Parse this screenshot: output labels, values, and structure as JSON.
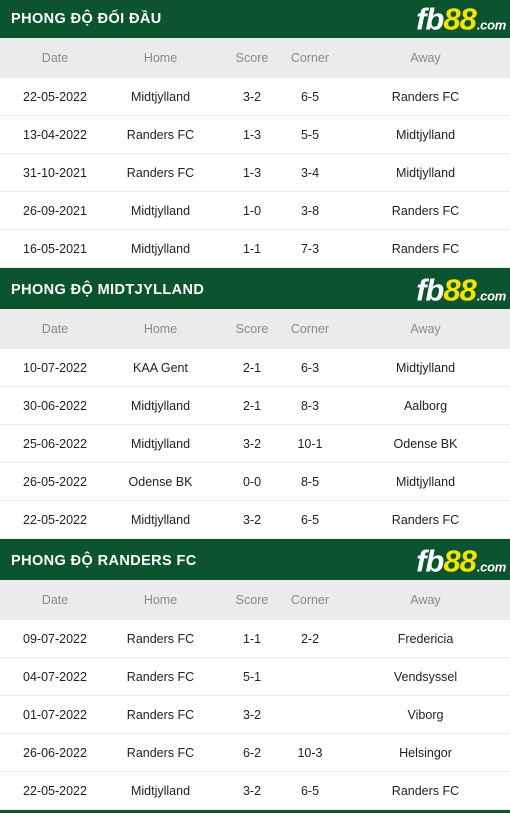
{
  "brand": {
    "fb": "fb",
    "eightyeight": "88",
    "com": ".com",
    "yellow": "#f5e400",
    "green": "#0c5330"
  },
  "colors": {
    "header_green": "#0c5330",
    "score_red": "#a33030",
    "midtjylland_orange": "#e8883a",
    "randers_blue": "#5ba9e0",
    "column_header_bg": "#ebebeb",
    "column_header_text": "#8a8a8a"
  },
  "columns": {
    "date": "Date",
    "home": "Home",
    "score": "Score",
    "corner": "Corner",
    "away": "Away"
  },
  "sections": [
    {
      "title": "PHONG ĐỘ ĐỐI ĐẦU",
      "rows": [
        {
          "date": "22-05-2022",
          "home": "Midtjylland",
          "home_style": "team-mid",
          "score": "3-2",
          "corner": "6-5",
          "away": "Randers FC",
          "away_style": "team-ran"
        },
        {
          "date": "13-04-2022",
          "home": "Randers FC",
          "home_style": "team-ran",
          "score": "1-3",
          "corner": "5-5",
          "away": "Midtjylland",
          "away_style": "team-mid"
        },
        {
          "date": "31-10-2021",
          "home": "Randers FC",
          "home_style": "team-ran",
          "score": "1-3",
          "corner": "3-4",
          "away": "Midtjylland",
          "away_style": "team-mid"
        },
        {
          "date": "26-09-2021",
          "home": "Midtjylland",
          "home_style": "team-mid",
          "score": "1-0",
          "corner": "3-8",
          "away": "Randers FC",
          "away_style": "team-ran"
        },
        {
          "date": "16-05-2021",
          "home": "Midtjylland",
          "home_style": "team-mid",
          "score": "1-1",
          "corner": "7-3",
          "away": "Randers FC",
          "away_style": "team-ran"
        }
      ]
    },
    {
      "title": "PHONG ĐỘ MIDTJYLLAND",
      "rows": [
        {
          "date": "10-07-2022",
          "home": "KAA Gent",
          "home_style": "team-neutral",
          "score": "2-1",
          "corner": "6-3",
          "away": "Midtjylland",
          "away_style": "team-mid"
        },
        {
          "date": "30-06-2022",
          "home": "Midtjylland",
          "home_style": "team-mid",
          "score": "2-1",
          "corner": "8-3",
          "away": "Aalborg",
          "away_style": "team-neutral"
        },
        {
          "date": "25-06-2022",
          "home": "Midtjylland",
          "home_style": "team-mid",
          "score": "3-2",
          "corner": "10-1",
          "away": "Odense BK",
          "away_style": "team-neutral"
        },
        {
          "date": "26-05-2022",
          "home": "Odense BK",
          "home_style": "team-neutral",
          "score": "0-0",
          "corner": "8-5",
          "away": "Midtjylland",
          "away_style": "team-mid"
        },
        {
          "date": "22-05-2022",
          "home": "Midtjylland",
          "home_style": "team-mid",
          "score": "3-2",
          "corner": "6-5",
          "away": "Randers FC",
          "away_style": "team-neutral"
        }
      ]
    },
    {
      "title": "PHONG ĐỘ RANDERS FC",
      "rows": [
        {
          "date": "09-07-2022",
          "home": "Randers FC",
          "home_style": "team-ran",
          "score": "1-1",
          "corner": "2-2",
          "away": "Fredericia",
          "away_style": "team-neutral"
        },
        {
          "date": "04-07-2022",
          "home": "Randers FC",
          "home_style": "team-ran",
          "score": "5-1",
          "corner": "",
          "away": "Vendsyssel",
          "away_style": "team-neutral"
        },
        {
          "date": "01-07-2022",
          "home": "Randers FC",
          "home_style": "team-ran",
          "score": "3-2",
          "corner": "",
          "away": "Viborg",
          "away_style": "team-neutral"
        },
        {
          "date": "26-06-2022",
          "home": "Randers FC",
          "home_style": "team-ran",
          "score": "6-2",
          "corner": "10-3",
          "away": "Helsingor",
          "away_style": "team-neutral"
        },
        {
          "date": "22-05-2022",
          "home": "Midtjylland",
          "home_style": "team-neutral",
          "score": "3-2",
          "corner": "6-5",
          "away": "Randers FC",
          "away_style": "team-ran"
        }
      ]
    }
  ]
}
